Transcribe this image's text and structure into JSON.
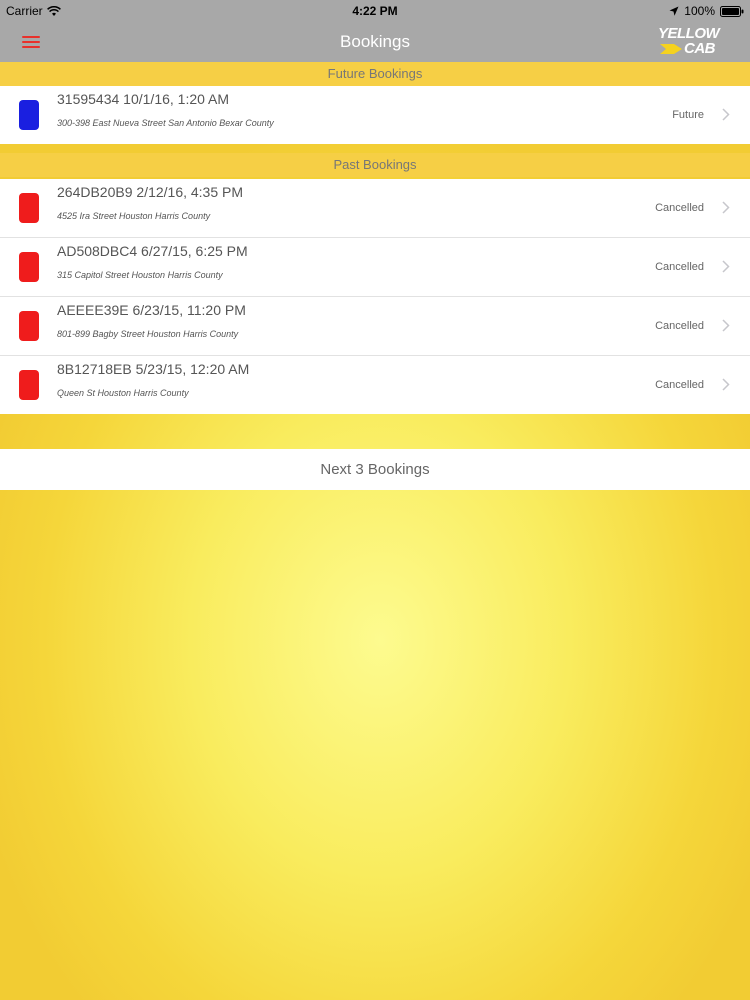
{
  "status_bar": {
    "carrier": "Carrier",
    "time": "4:22 PM",
    "battery": "100%"
  },
  "nav": {
    "title": "Bookings",
    "logo_line1": "YELLOW",
    "logo_line2": "CAB"
  },
  "sections": {
    "future": {
      "header": "Future Bookings",
      "items": [
        {
          "title": "31595434 10/1/16, 1:20 AM",
          "address": "300-398 East Nueva Street San Antonio Bexar County",
          "status": "Future",
          "color": "#1a1fe0"
        }
      ]
    },
    "past": {
      "header": "Past Bookings",
      "items": [
        {
          "title": "264DB20B9 2/12/16, 4:35 PM",
          "address": "4525 Ira Street Houston Harris County",
          "status": "Cancelled",
          "color": "#ef1c1c"
        },
        {
          "title": "AD508DBC4 6/27/15, 6:25 PM",
          "address": "315 Capitol Street Houston Harris County",
          "status": "Cancelled",
          "color": "#ef1c1c"
        },
        {
          "title": "AEEEE39E 6/23/15, 11:20 PM",
          "address": "801-899 Bagby Street Houston Harris County",
          "status": "Cancelled",
          "color": "#ef1c1c"
        },
        {
          "title": "8B12718EB 5/23/15, 12:20 AM",
          "address": "Queen St Houston Harris County",
          "status": "Cancelled",
          "color": "#ef1c1c"
        }
      ]
    }
  },
  "next_button": {
    "label": "Next 3 Bookings"
  },
  "icons": {
    "menu": "menu-icon",
    "wifi": "wifi-icon",
    "location": "location-icon",
    "battery": "battery-icon",
    "chevron": "chevron-right-icon"
  }
}
